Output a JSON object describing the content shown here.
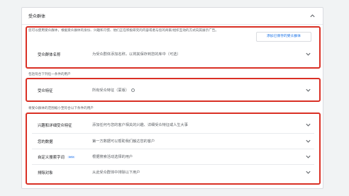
{
  "panel": {
    "title": "受众群体",
    "intro": "您可以使用受众群体，根据受众群体的身份、兴趣和习惯、他们正在积极研究的内容或者与您的商家/组织互动的方式向其展示广告。",
    "open_saved_button": "添加已保存的受众群体",
    "name_row": {
      "label": "受众群体名称",
      "placeholder": "为受众群体添加名称，以将其保存到您的库中（可选）"
    },
    "include_heading": "包括符合下列任一条件的用户",
    "feature_row": {
      "label": "受众特征",
      "value": "所有受众特征（蒙版）"
    },
    "narrow_heading": "将受众群体的范围缩小至符合以下条件的用户",
    "rows": [
      {
        "label": "兴趣和详细受众特征",
        "desc": "添加任何与您的客户相关的兴趣、详细受众特征或人生大事"
      },
      {
        "label": "您的数据",
        "desc": "第一方数据可以帮助我们触达您的客户"
      },
      {
        "label": "自定义搜索字词",
        "badge": "beta",
        "desc": "根据搜索活动选择的用户"
      },
      {
        "label": "排除对象",
        "desc": "从此受众群体中排除以下用户"
      }
    ]
  }
}
